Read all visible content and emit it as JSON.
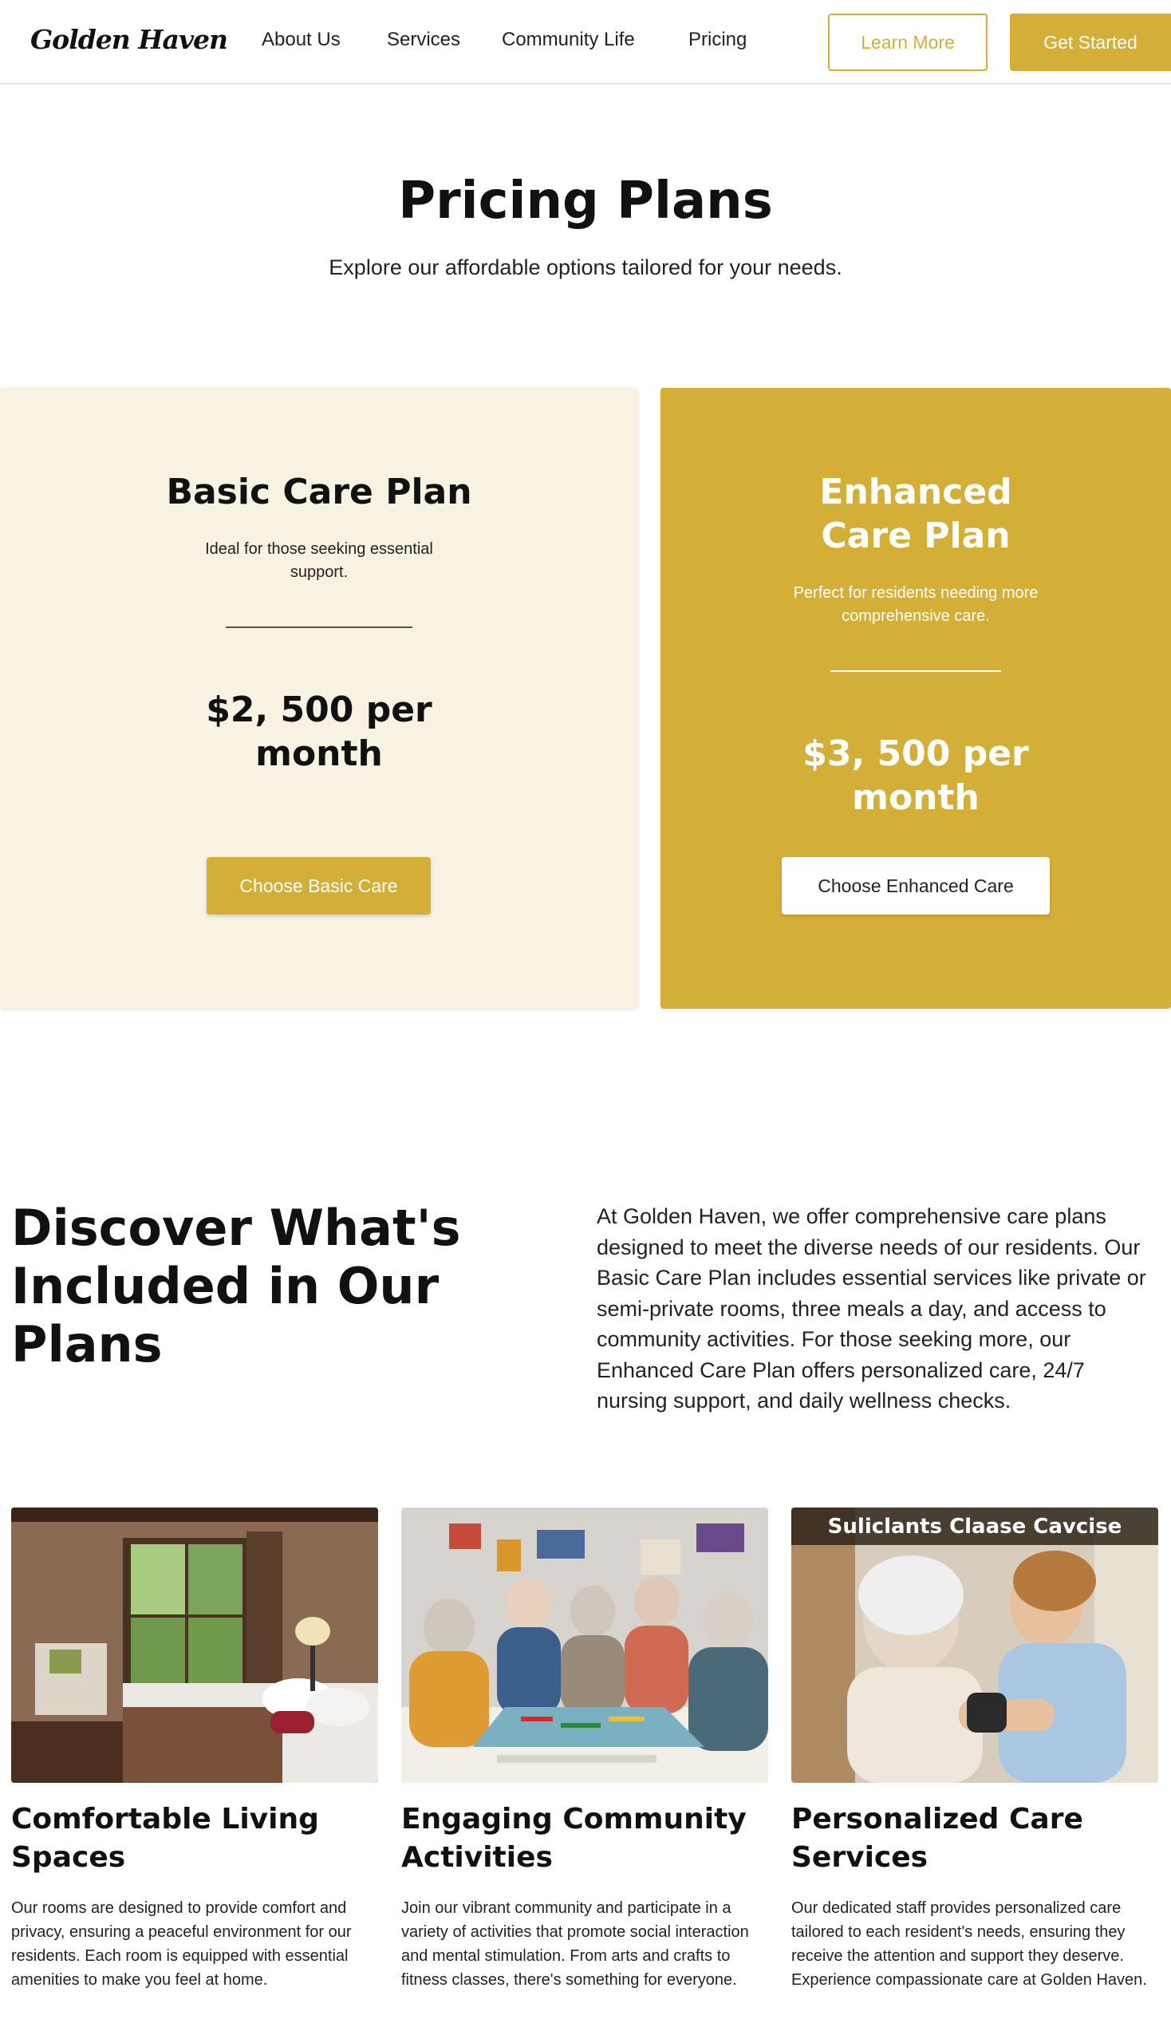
{
  "nav": {
    "logo": "Golden Haven",
    "links": [
      "About Us",
      "Services",
      "Community Life",
      "Pricing"
    ],
    "learn_more": "Learn More",
    "get_started": "Get Started"
  },
  "hero": {
    "title": "Pricing Plans",
    "subtitle": "Explore our affordable options tailored for your needs."
  },
  "plans": [
    {
      "title": "Basic Care Plan",
      "description": "Ideal for those seeking essential support.",
      "price": "$2, 500 per month",
      "button": "Choose Basic Care"
    },
    {
      "title": "Enhanced Care Plan",
      "description": "Perfect for residents needing more comprehensive care.",
      "price": "$3, 500 per month",
      "button": "Choose Enhanced Care"
    }
  ],
  "discover": {
    "title": "Discover What's Included in Our Plans",
    "text": "At Golden Haven, we offer comprehensive care plans designed to meet the diverse needs of our residents. Our Basic Care Plan includes essential services like private or semi-private rooms, three meals a day, and access to community activities. For those seeking more, our Enhanced Care Plan offers personalized care, 24/7 nursing support, and daily wellness checks."
  },
  "features": [
    {
      "title": "Comfortable Living Spaces",
      "text": "Our rooms are designed to provide comfort and privacy, ensuring a peaceful environment for our residents. Each room is equipped with essential amenities to make you feel at home."
    },
    {
      "title": "Engaging Community Activities",
      "text": "Join our vibrant community and participate in a variety of activities that promote social interaction and mental stimulation. From arts and crafts to fitness classes, there's something for everyone."
    },
    {
      "title": "Personalized Care Services",
      "text": "Our dedicated staff provides personalized care tailored to each resident's needs, ensuring they receive the attention and support they deserve. Experience compassionate care at Golden Haven.",
      "image_banner": "Suliclants Claase Cavcise"
    }
  ],
  "colors": {
    "accent": "#d4af37",
    "cream": "#f7f2e1"
  }
}
